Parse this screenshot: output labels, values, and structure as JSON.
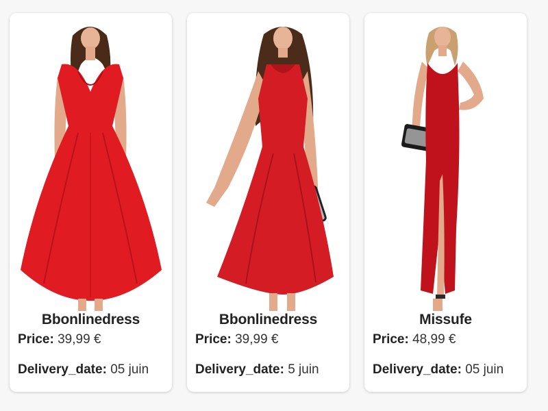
{
  "products": [
    {
      "name": "Bbonlinedress",
      "price_label": "Price:",
      "price": "39,99 €",
      "delivery_label": "Delivery_date:",
      "delivery": "05 juin",
      "image_icon": "red-swing-dress-photo",
      "dress_color": "#e01b22"
    },
    {
      "name": "Bbonlinedress",
      "price_label": "Price:",
      "price": "39,99 €",
      "delivery_label": "Delivery_date:",
      "delivery": "5 juin",
      "image_icon": "red-halter-dress-photo",
      "dress_color": "#d41c24"
    },
    {
      "name": "Missufe",
      "price_label": "Price:",
      "price": "48,99 €",
      "delivery_label": "Delivery_date:",
      "delivery": "05 juin",
      "image_icon": "red-maxi-dress-photo",
      "dress_color": "#c0121c"
    }
  ]
}
